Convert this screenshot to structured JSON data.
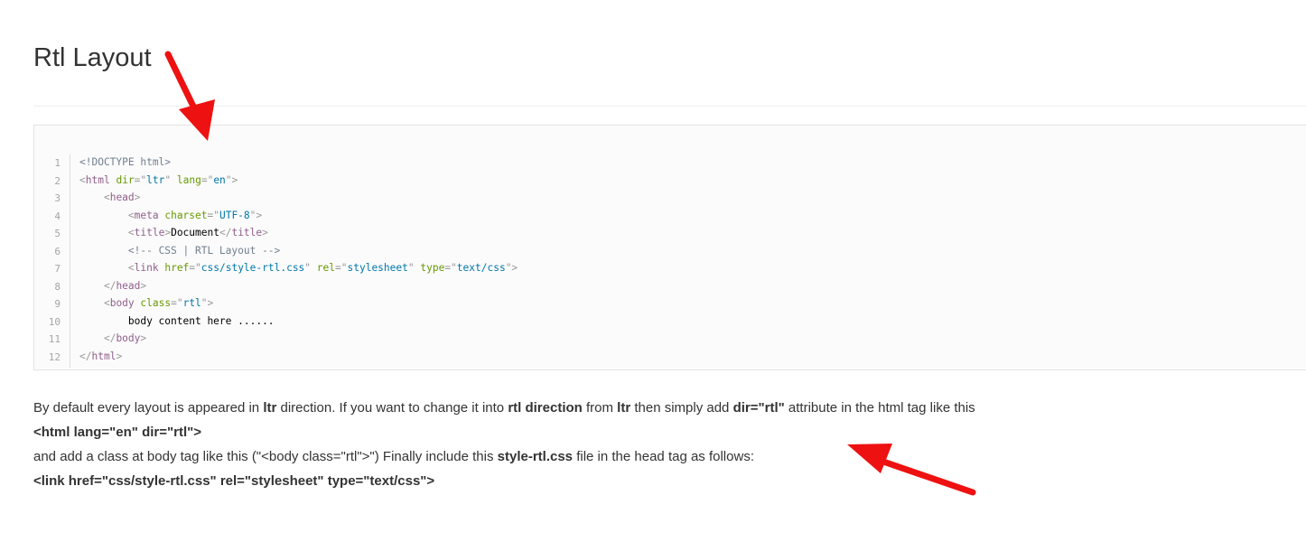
{
  "page": {
    "title": "Rtl Layout"
  },
  "code_block": {
    "language": "html",
    "line_numbers": [
      "1",
      "2",
      "3",
      "4",
      "5",
      "6",
      "7",
      "8",
      "9",
      "10",
      "11",
      "12"
    ],
    "lines": [
      [
        {
          "t": "doctype",
          "v": "<!DOCTYPE html>"
        }
      ],
      [
        {
          "t": "punct",
          "v": "<"
        },
        {
          "t": "tag",
          "v": "html"
        },
        {
          "t": "text",
          "v": " "
        },
        {
          "t": "attr",
          "v": "dir"
        },
        {
          "t": "punct",
          "v": "=\""
        },
        {
          "t": "val",
          "v": "ltr"
        },
        {
          "t": "punct",
          "v": "\""
        },
        {
          "t": "text",
          "v": " "
        },
        {
          "t": "attr",
          "v": "lang"
        },
        {
          "t": "punct",
          "v": "=\""
        },
        {
          "t": "val",
          "v": "en"
        },
        {
          "t": "punct",
          "v": "\">"
        }
      ],
      [
        {
          "t": "text",
          "v": "    "
        },
        {
          "t": "punct",
          "v": "<"
        },
        {
          "t": "tag",
          "v": "head"
        },
        {
          "t": "punct",
          "v": ">"
        }
      ],
      [
        {
          "t": "text",
          "v": "        "
        },
        {
          "t": "punct",
          "v": "<"
        },
        {
          "t": "tag",
          "v": "meta"
        },
        {
          "t": "text",
          "v": " "
        },
        {
          "t": "attr",
          "v": "charset"
        },
        {
          "t": "punct",
          "v": "=\""
        },
        {
          "t": "val",
          "v": "UTF-8"
        },
        {
          "t": "punct",
          "v": "\">"
        }
      ],
      [
        {
          "t": "text",
          "v": "        "
        },
        {
          "t": "punct",
          "v": "<"
        },
        {
          "t": "tag",
          "v": "title"
        },
        {
          "t": "punct",
          "v": ">"
        },
        {
          "t": "text",
          "v": "Document"
        },
        {
          "t": "punct",
          "v": "</"
        },
        {
          "t": "tag",
          "v": "title"
        },
        {
          "t": "punct",
          "v": ">"
        }
      ],
      [
        {
          "t": "text",
          "v": "        "
        },
        {
          "t": "comment",
          "v": "<!-- CSS | RTL Layout -->"
        }
      ],
      [
        {
          "t": "text",
          "v": "        "
        },
        {
          "t": "punct",
          "v": "<"
        },
        {
          "t": "tag",
          "v": "link"
        },
        {
          "t": "text",
          "v": " "
        },
        {
          "t": "attr",
          "v": "href"
        },
        {
          "t": "punct",
          "v": "=\""
        },
        {
          "t": "val",
          "v": "css/style-rtl.css"
        },
        {
          "t": "punct",
          "v": "\""
        },
        {
          "t": "text",
          "v": " "
        },
        {
          "t": "attr",
          "v": "rel"
        },
        {
          "t": "punct",
          "v": "=\""
        },
        {
          "t": "val",
          "v": "stylesheet"
        },
        {
          "t": "punct",
          "v": "\""
        },
        {
          "t": "text",
          "v": " "
        },
        {
          "t": "attr",
          "v": "type"
        },
        {
          "t": "punct",
          "v": "=\""
        },
        {
          "t": "val",
          "v": "text/css"
        },
        {
          "t": "punct",
          "v": "\">"
        }
      ],
      [
        {
          "t": "text",
          "v": "    "
        },
        {
          "t": "punct",
          "v": "</"
        },
        {
          "t": "tag",
          "v": "head"
        },
        {
          "t": "punct",
          "v": ">"
        }
      ],
      [
        {
          "t": "text",
          "v": "    "
        },
        {
          "t": "punct",
          "v": "<"
        },
        {
          "t": "tag",
          "v": "body"
        },
        {
          "t": "text",
          "v": " "
        },
        {
          "t": "attr",
          "v": "class"
        },
        {
          "t": "punct",
          "v": "=\""
        },
        {
          "t": "val",
          "v": "rtl"
        },
        {
          "t": "punct",
          "v": "\">"
        }
      ],
      [
        {
          "t": "text",
          "v": "        body content here ......"
        }
      ],
      [
        {
          "t": "text",
          "v": "    "
        },
        {
          "t": "punct",
          "v": "</"
        },
        {
          "t": "tag",
          "v": "body"
        },
        {
          "t": "punct",
          "v": ">"
        }
      ],
      [
        {
          "t": "punct",
          "v": "</"
        },
        {
          "t": "tag",
          "v": "html"
        },
        {
          "t": "punct",
          "v": ">"
        }
      ]
    ]
  },
  "description": {
    "line1": {
      "p1": "By default every layout is appeared in ",
      "b1": "ltr",
      "p2": " direction. If you want to change it into ",
      "b2": "rtl direction",
      "p3": " from ",
      "b3": "ltr",
      "p4": " then simply add ",
      "b4": "dir=\"rtl\"",
      "p5": " attribute in the html tag like this"
    },
    "line2": "<html lang=\"en\" dir=\"rtl\">",
    "line3": {
      "p1": "and add a class at body tag like this (\"<body class=\"rtl\">\") Finally include this ",
      "b1": "style-rtl.css",
      "p2": " file in the head tag as follows:"
    },
    "line4": "<link href=\"css/style-rtl.css\" rel=\"stylesheet\" type=\"text/css\">"
  },
  "annotations": {
    "arrow_color": "#ee1111",
    "arrow_count": 2
  }
}
